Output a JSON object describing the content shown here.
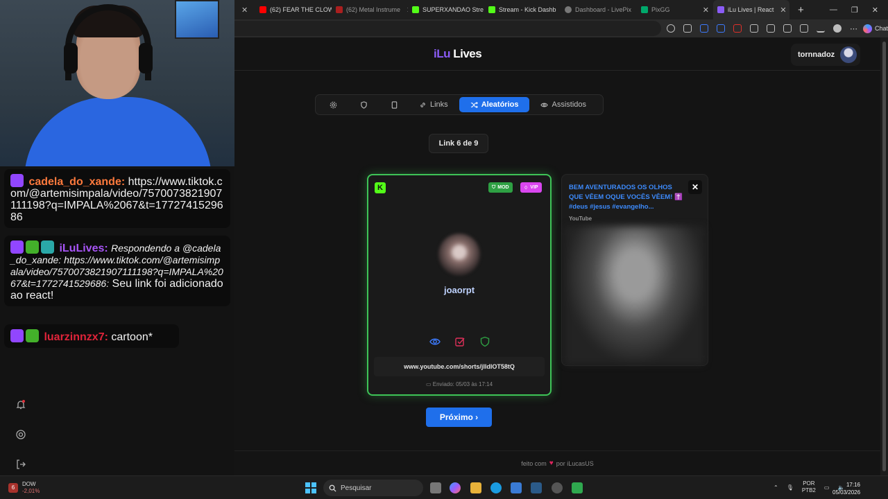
{
  "browser": {
    "tabs": [
      {
        "label": "",
        "color": "#8a8a8a"
      },
      {
        "label": "(62) FEAR THE CLOW",
        "color": "#ff0000"
      },
      {
        "label": "(62) Metal Instrume",
        "color": "#ff0000"
      },
      {
        "label": "SUPERXANDAO Stre",
        "color": "#53fc18"
      },
      {
        "label": "Stream - Kick Dashb",
        "color": "#53fc18"
      },
      {
        "label": "Dashboard - LivePix",
        "color": "#777777"
      },
      {
        "label": "PixGG",
        "color": "#00a86b"
      },
      {
        "label": "iLu Lives | React",
        "color": "#8b5cf6"
      }
    ],
    "chat_label": "Chat"
  },
  "page": {
    "brand_part1": "iLu",
    "brand_part2": "Lives",
    "username": "tornnadoz",
    "nav": [
      {
        "label": "",
        "icon": "gear-icon"
      },
      {
        "label": "",
        "icon": "shield-icon"
      },
      {
        "label": "",
        "icon": "bookmark-icon"
      },
      {
        "label": "Links",
        "icon": "link-icon"
      },
      {
        "label": "Aleatórios",
        "icon": "shuffle-icon",
        "active": true
      },
      {
        "label": "Assistidos",
        "icon": "eye-icon"
      }
    ],
    "counter": "Link 6 de 9",
    "current_card": {
      "platform": "K",
      "badge_mod": "MOD",
      "badge_vip": "VIP",
      "username": "joaorpt",
      "url": "www.youtube.com/shorts/jlldIOT58tQ",
      "sent": "Enviado: 05/03 às 17:14"
    },
    "next_card": {
      "title": "BEM AVENTURADOS OS OLHOS QUE VÊEM OQUE VOCÊS VÊEM! ✝️ #deus #jesus #evangelho...",
      "source": "YouTube",
      "close": "✕"
    },
    "next_button": "Próximo ›",
    "footer": {
      "prefix": "feito com",
      "heart": "♥",
      "suffix": "por iLucasUS"
    },
    "accent": "#1f6feb",
    "highlight": "#3ec457"
  },
  "chat": [
    {
      "user": "cadela_do_xande:",
      "user_color": "#ff7a3d",
      "text": "https://www.tiktok.com/@artemisimpala/video/7570073821907111198?q=IMPALA%2067&t=1772741529686"
    },
    {
      "user": "iLuLives:",
      "user_color": "#a855f7",
      "italic": "Respondendo a @cadela_do_xande: https://www.tiktok.com/@artemisimpala/video/7570073821907111198?q=IMPALA%2067&t=1772741529686:",
      "text": "Seu link foi adicionado ao react!"
    },
    {
      "user": "luarzinnzx7:",
      "user_color": "#e0243a",
      "text": "cartoon*"
    }
  ],
  "taskbar": {
    "stock_name": "DOW",
    "stock_change": "-2,01%",
    "stock_badge": "6",
    "search": "Pesquisar",
    "lang1": "POR",
    "lang2": "PTB2",
    "time": "17:16",
    "date": "05/03/2026"
  }
}
